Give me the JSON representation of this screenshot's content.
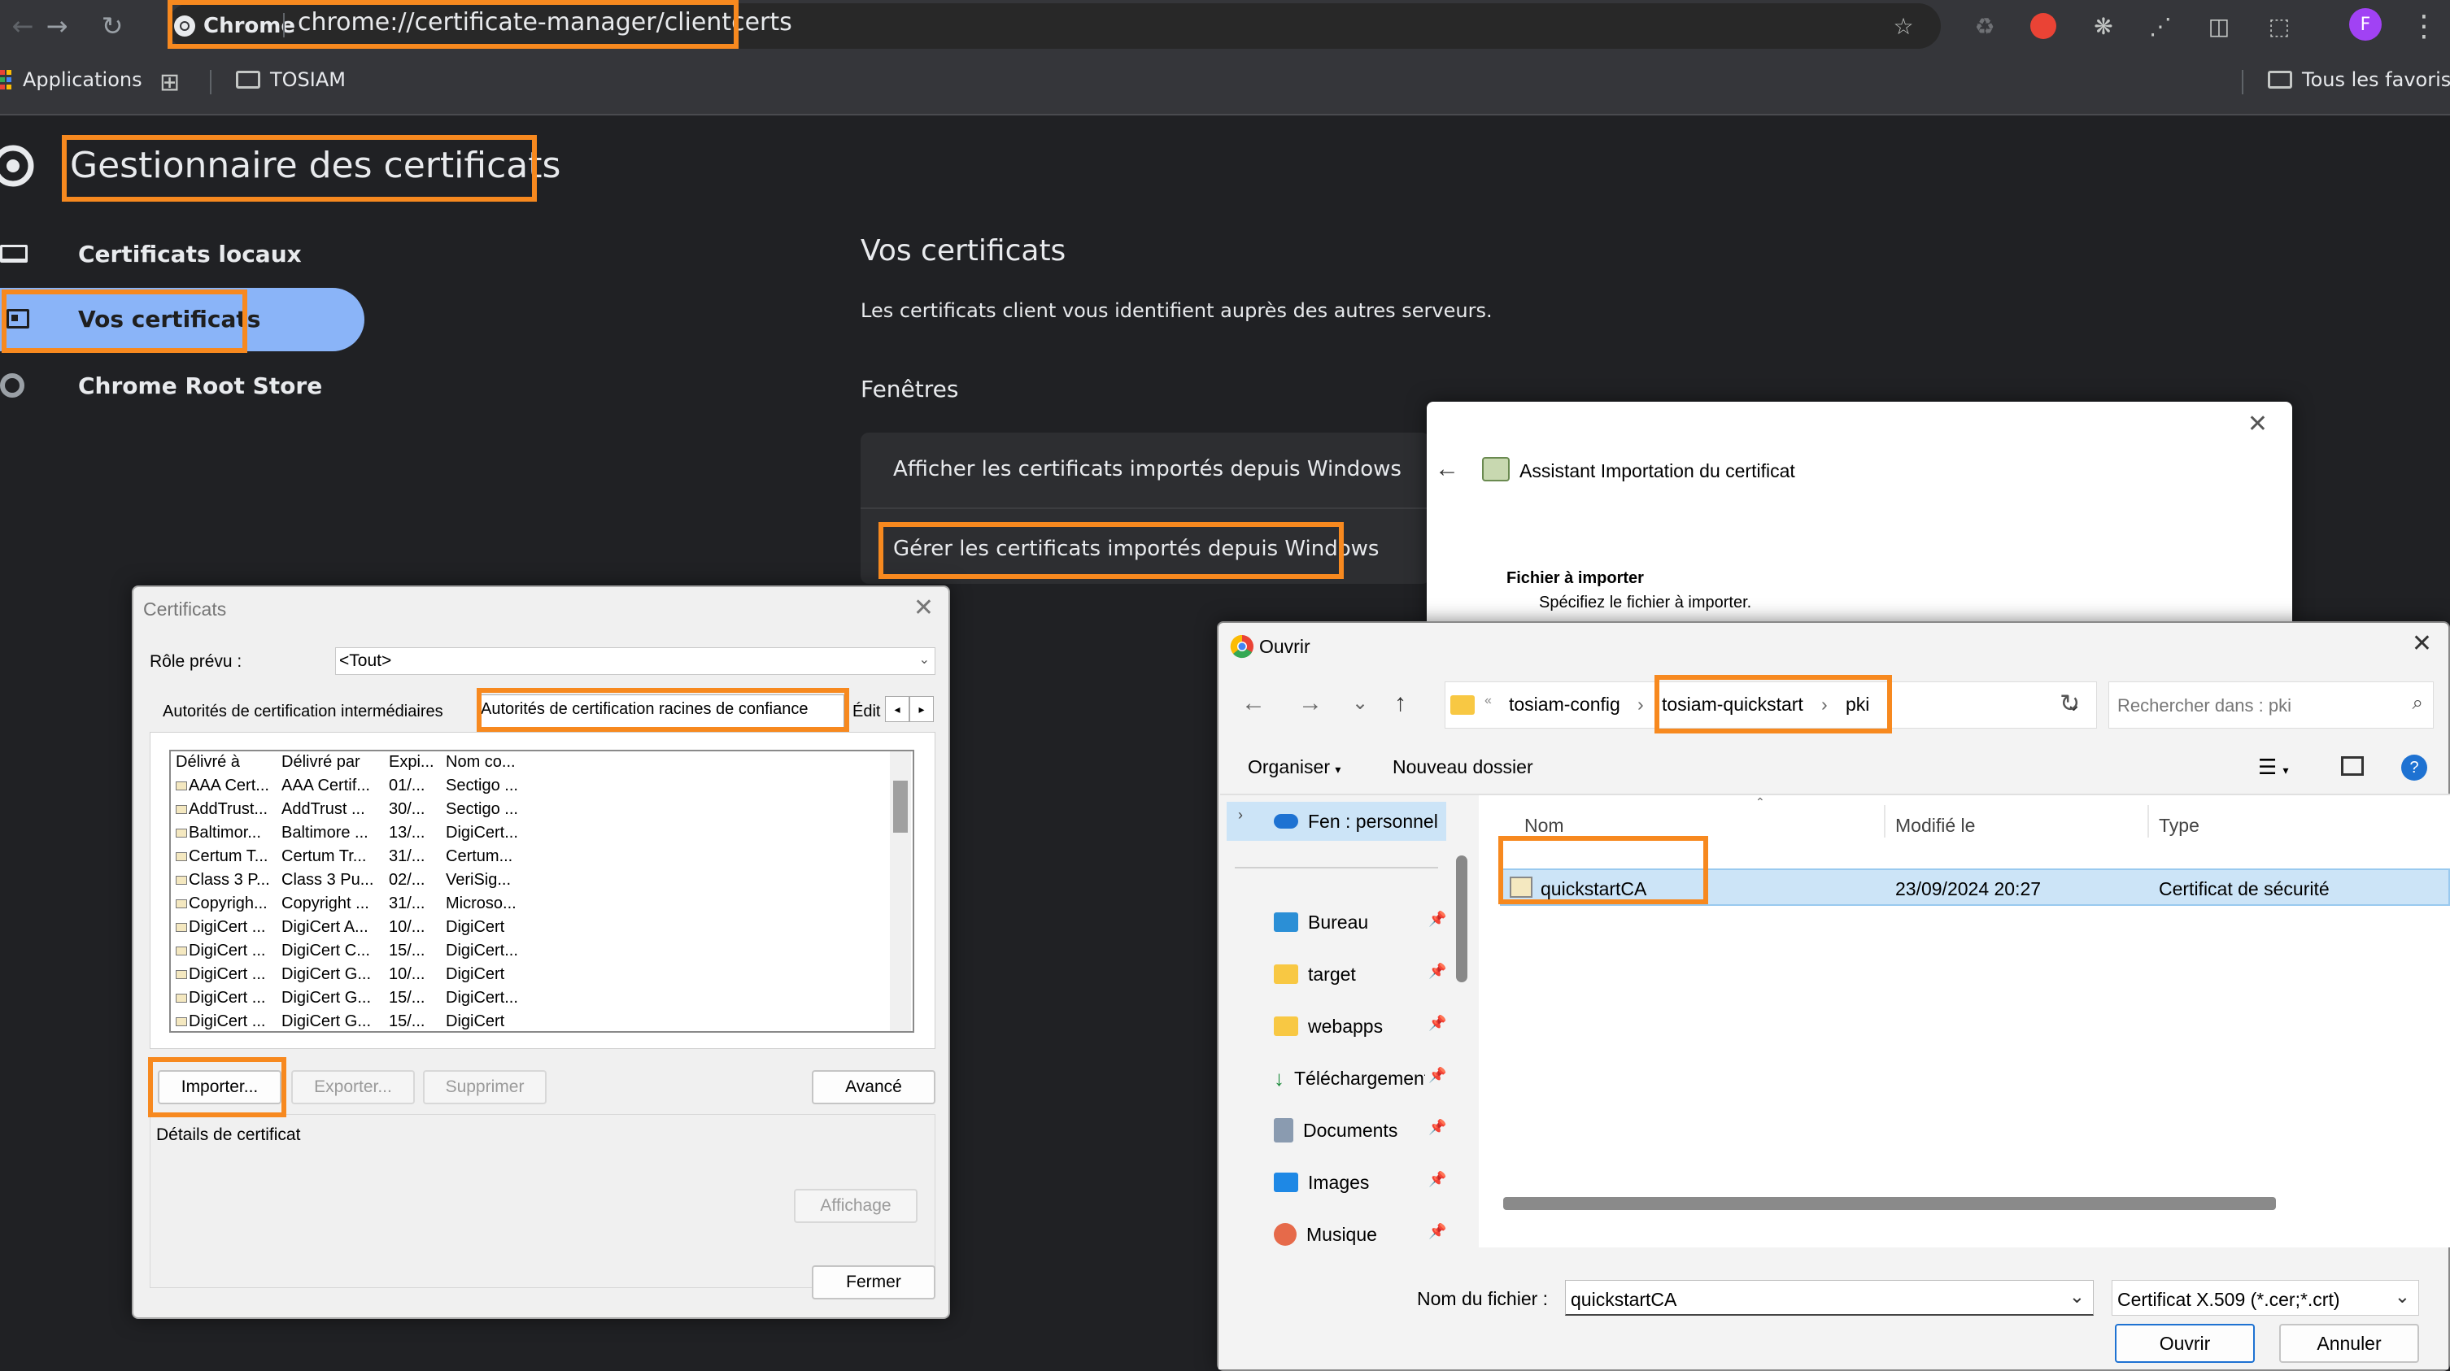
{
  "browser": {
    "chip_label": "Chrome",
    "url": "chrome://certificate-manager/clientcerts",
    "bookmarks": [
      {
        "label": "Applications"
      },
      {
        "label": "TOSIAM"
      }
    ],
    "all_bookmarks": "Tous les favoris",
    "profile_initial": "F"
  },
  "page": {
    "title": "Gestionnaire des certificats",
    "nav": [
      {
        "label": "Certificats locaux"
      },
      {
        "label": "Vos certificats"
      },
      {
        "label": "Chrome Root Store"
      }
    ],
    "section_title": "Vos certificats",
    "section_desc": "Les certificats client vous identifient auprès des autres serveurs.",
    "subsection": "Fenêtres",
    "rows": [
      {
        "label": "Afficher les certificats importés depuis Windows"
      },
      {
        "label": "Gérer les certificats importés depuis Windows"
      }
    ]
  },
  "wizard": {
    "title": "Assistant Importation du certificat",
    "heading": "Fichier à importer",
    "subheading": "Spécifiez le fichier à importer."
  },
  "certs_dialog": {
    "title": "Certificats",
    "role_label": "Rôle prévu :",
    "role_value": "<Tout>",
    "tabs": [
      {
        "label": "Autorités de certification intermédiaires"
      },
      {
        "label": "Autorités de certification racines de confiance"
      },
      {
        "label": "Édit"
      }
    ],
    "columns": [
      "Délivré à",
      "Délivré par",
      "Expi...",
      "Nom co..."
    ],
    "rows": [
      {
        "to": "AAA Cert...",
        "by": "AAA Certif...",
        "exp": "01/...",
        "name": "Sectigo ..."
      },
      {
        "to": "AddTrust...",
        "by": "AddTrust ...",
        "exp": "30/...",
        "name": "Sectigo ..."
      },
      {
        "to": "Baltimor...",
        "by": "Baltimore ...",
        "exp": "13/...",
        "name": "DigiCert..."
      },
      {
        "to": "Certum T...",
        "by": "Certum Tr...",
        "exp": "31/...",
        "name": "Certum..."
      },
      {
        "to": "Class 3 P...",
        "by": "Class 3 Pu...",
        "exp": "02/...",
        "name": "VeriSig..."
      },
      {
        "to": "Copyrigh...",
        "by": "Copyright ...",
        "exp": "31/...",
        "name": "Microso..."
      },
      {
        "to": "DigiCert ...",
        "by": "DigiCert A...",
        "exp": "10/...",
        "name": "DigiCert"
      },
      {
        "to": "DigiCert ...",
        "by": "DigiCert C...",
        "exp": "15/...",
        "name": "DigiCert..."
      },
      {
        "to": "DigiCert ...",
        "by": "DigiCert G...",
        "exp": "10/...",
        "name": "DigiCert"
      },
      {
        "to": "DigiCert ...",
        "by": "DigiCert G...",
        "exp": "15/...",
        "name": "DigiCert..."
      },
      {
        "to": "DigiCert ...",
        "by": "DigiCert G...",
        "exp": "15/...",
        "name": "DigiCert"
      }
    ],
    "buttons": {
      "import": "Importer...",
      "export": "Exporter...",
      "remove": "Supprimer",
      "advanced": "Avancé",
      "view": "Affichage",
      "close": "Fermer"
    },
    "details_label": "Détails de certificat"
  },
  "open_dialog": {
    "title": "Ouvrir",
    "breadcrumb": [
      {
        "label": "tosiam-config"
      },
      {
        "label": "tosiam-quickstart"
      },
      {
        "label": "pki"
      }
    ],
    "search_placeholder": "Rechercher dans : pki",
    "organize": "Organiser",
    "new_folder": "Nouveau dossier",
    "tree": [
      {
        "label": "Fen : personnel"
      },
      {
        "label": "Bureau"
      },
      {
        "label": "target"
      },
      {
        "label": "webapps"
      },
      {
        "label": "Téléchargements"
      },
      {
        "label": "Documents"
      },
      {
        "label": "Images"
      },
      {
        "label": "Musique"
      }
    ],
    "columns": {
      "name": "Nom",
      "modified": "Modifié le",
      "type": "Type"
    },
    "files": [
      {
        "name": "quickstartCA",
        "modified": "23/09/2024 20:27",
        "type": "Certificat de sécurité"
      }
    ],
    "filename_label": "Nom du fichier :",
    "filename_value": "quickstartCA",
    "filetype": "Certificat X.509 (*.cer;*.crt)",
    "open_btn": "Ouvrir",
    "cancel_btn": "Annuler"
  },
  "colors": {
    "accent": "#8ab4f8",
    "highlight": "#f7891f",
    "dark_bg": "#202124"
  }
}
